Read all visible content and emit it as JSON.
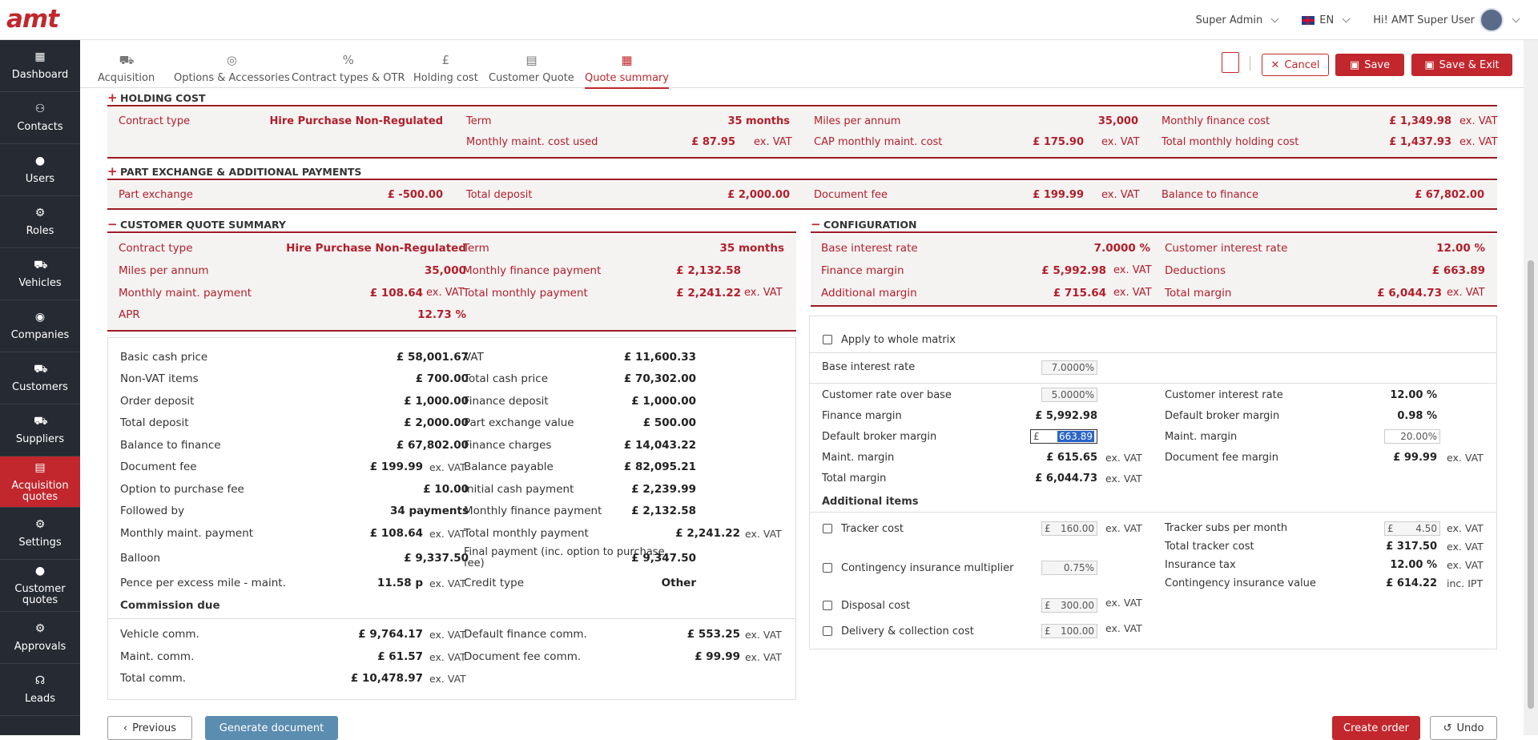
{
  "app": {
    "logo": "amt"
  },
  "topbar": {
    "role": "Super Admin",
    "lang": "EN",
    "greeting": "Hi! AMT Super User"
  },
  "sidebar": [
    {
      "label": "Dashboard",
      "icon": "dashboard-icon"
    },
    {
      "label": "Contacts",
      "icon": "contacts-icon"
    },
    {
      "label": "Users",
      "icon": "user-icon"
    },
    {
      "label": "Roles",
      "icon": "roles-icon"
    },
    {
      "label": "Vehicles",
      "icon": "car-icon"
    },
    {
      "label": "Companies",
      "icon": "companies-icon"
    },
    {
      "label": "Customers",
      "icon": "customers-icon"
    },
    {
      "label": "Suppliers",
      "icon": "suppliers-icon"
    },
    {
      "label": "Acquisition quotes",
      "icon": "document-icon"
    },
    {
      "label": "Settings",
      "icon": "gear-icon"
    },
    {
      "label": "Customer quotes",
      "icon": "customer-quotes-icon"
    },
    {
      "label": "Approvals",
      "icon": "approvals-icon"
    },
    {
      "label": "Leads",
      "icon": "headset-icon"
    }
  ],
  "tabs": [
    "Acquisition",
    "Options & Accessories",
    "Contract types & OTR",
    "Holding cost",
    "Customer Quote",
    "Quote summary"
  ],
  "actions": {
    "cancel": "Cancel",
    "save": "Save",
    "save_exit": "Save & Exit"
  },
  "holding": {
    "title": "HOLDING COST",
    "contract_type_label": "Contract type",
    "contract_type": "Hire Purchase Non-Regulated",
    "term_label": "Term",
    "term": "35 months",
    "miles_label": "Miles per annum",
    "miles": "35,000",
    "mfc_label": "Monthly finance cost",
    "mfc": "£ 1,349.98",
    "mmcu_label": "Monthly maint. cost used",
    "mmcu": "£ 87.95",
    "cap_label": "CAP monthly maint. cost",
    "cap": "£ 175.90",
    "tmhc_label": "Total monthly holding cost",
    "tmhc": "£ 1,437.93",
    "exvat": "ex. VAT"
  },
  "partex": {
    "title": "PART EXCHANGE & ADDITIONAL PAYMENTS",
    "pe_label": "Part exchange",
    "pe": "£ -500.00",
    "td_label": "Total deposit",
    "td": "£ 2,000.00",
    "df_label": "Document fee",
    "df": "£ 199.99",
    "btf_label": "Balance to finance",
    "btf": "£ 67,802.00"
  },
  "cqs": {
    "title": "CUSTOMER QUOTE SUMMARY",
    "ct_label": "Contract type",
    "ct": "Hire Purchase Non-Regulated",
    "term_label": "Term",
    "term": "35 months",
    "miles_label": "Miles per annum",
    "miles": "35,000",
    "mfp_label": "Monthly finance payment",
    "mfp": "£ 2,132.58",
    "mmp_label": "Monthly maint. payment",
    "mmp": "£ 108.64",
    "tmp_label": "Total monthly payment",
    "tmp": "£ 2,241.22",
    "apr_label": "APR",
    "apr": "12.73 %"
  },
  "config": {
    "title": "CONFIGURATION",
    "bir_label": "Base interest rate",
    "bir": "7.0000 %",
    "cir_label": "Customer interest rate",
    "cir": "12.00 %",
    "fm_label": "Finance margin",
    "fm": "£ 5,992.98",
    "ded_label": "Deductions",
    "ded": "£ 663.89",
    "am_label": "Additional margin",
    "am": "£ 715.64",
    "tm_label": "Total margin",
    "tm": "£ 6,044.73"
  },
  "details": {
    "left": [
      {
        "label": "Basic cash price",
        "value": "£ 58,001.67",
        "unit": ""
      },
      {
        "label": "Non-VAT items",
        "value": "£ 700.00",
        "unit": ""
      },
      {
        "label": "Order deposit",
        "value": "£ 1,000.00",
        "unit": ""
      },
      {
        "label": "Total deposit",
        "value": "£ 2,000.00",
        "unit": ""
      },
      {
        "label": "Balance to finance",
        "value": "£ 67,802.00",
        "unit": ""
      },
      {
        "label": "Document fee",
        "value": "£ 199.99",
        "unit": "ex. VAT"
      },
      {
        "label": "Option to purchase fee",
        "value": "£ 10.00",
        "unit": ""
      },
      {
        "label": "Followed by",
        "value": "34 payments",
        "unit": ""
      },
      {
        "label": "Monthly maint. payment",
        "value": "£ 108.64",
        "unit": "ex. VAT"
      },
      {
        "label": "Balloon",
        "value": "£ 9,337.50",
        "unit": ""
      },
      {
        "label": "Pence per excess mile - maint.",
        "value": "11.58 p",
        "unit": "ex. VAT"
      }
    ],
    "right": [
      {
        "label": "VAT",
        "value": "£ 11,600.33",
        "unit": ""
      },
      {
        "label": "Total cash price",
        "value": "£ 70,302.00",
        "unit": ""
      },
      {
        "label": "Finance deposit",
        "value": "£ 1,000.00",
        "unit": ""
      },
      {
        "label": "Part exchange value",
        "value": "£ 500.00",
        "unit": ""
      },
      {
        "label": "Finance charges",
        "value": "£ 14,043.22",
        "unit": ""
      },
      {
        "label": "Balance payable",
        "value": "£ 82,095.21",
        "unit": ""
      },
      {
        "label": "Initial cash payment",
        "value": "£ 2,239.99",
        "unit": ""
      },
      {
        "label": "Monthly finance payment",
        "value": "£ 2,132.58",
        "unit": ""
      },
      {
        "label": "Total monthly payment",
        "value": "£ 2,241.22",
        "unit": "ex. VAT"
      },
      {
        "label": "Final payment (inc. option to purchase fee)",
        "value": "£ 9,347.50",
        "unit": ""
      },
      {
        "label": "Credit type",
        "value": "Other",
        "unit": ""
      }
    ],
    "commission_title": "Commission due",
    "commission": [
      {
        "label": "Vehicle comm.",
        "value": "£ 9,764.17",
        "unit": "ex. VAT"
      },
      {
        "label": "Default finance comm.",
        "value": "£ 553.25",
        "unit": "ex. VAT"
      },
      {
        "label": "Maint. comm.",
        "value": "£ 61.57",
        "unit": "ex. VAT"
      },
      {
        "label": "Document fee comm.",
        "value": "£ 99.99",
        "unit": "ex. VAT"
      },
      {
        "label": "Total comm.",
        "value": "£ 10,478.97",
        "unit": "ex. VAT"
      }
    ]
  },
  "configpanel": {
    "apply_label": "Apply to whole matrix",
    "bir_label": "Base interest rate",
    "bir_input": "7.0000",
    "crob_label": "Customer rate over base",
    "crob_input": "5.0000",
    "cir_label": "Customer interest rate",
    "cir": "12.00 %",
    "fm_label": "Finance margin",
    "fm": "£ 5,992.98",
    "dbm_label": "Default broker margin",
    "dbm": "0.98 %",
    "dbm2_label": "Default broker margin",
    "dbm_input": "663.89",
    "mm_label": "Maint. margin",
    "mm_input": "20.00",
    "mm2_label": "Maint. margin",
    "mm2": "£ 615.65",
    "dfm_label": "Document fee margin",
    "dfm": "£ 99.99",
    "tm_label": "Total margin",
    "tm": "£ 6,044.73",
    "additional_title": "Additional items",
    "tracker_label": "Tracker cost",
    "tracker_input": "160.00",
    "tsm_label": "Tracker subs per month",
    "tsm_input": "4.50",
    "ttc_label": "Total tracker cost",
    "ttc": "£ 317.50",
    "cim_label": "Contingency insurance multiplier",
    "cim_input": "0.75",
    "it_label": "Insurance tax",
    "it": "12.00 %",
    "civ_label": "Contingency insurance value",
    "civ": "£ 614.22",
    "inc_ipt": "inc. IPT",
    "disp_label": "Disposal cost",
    "disp_input": "300.00",
    "dcc_label": "Delivery & collection cost",
    "dcc_input": "100.00",
    "pct": "%",
    "pound": "£",
    "exvat": "ex. VAT"
  },
  "footer": {
    "previous": "Previous",
    "generate": "Generate document",
    "create_order": "Create order",
    "undo": "Undo"
  }
}
